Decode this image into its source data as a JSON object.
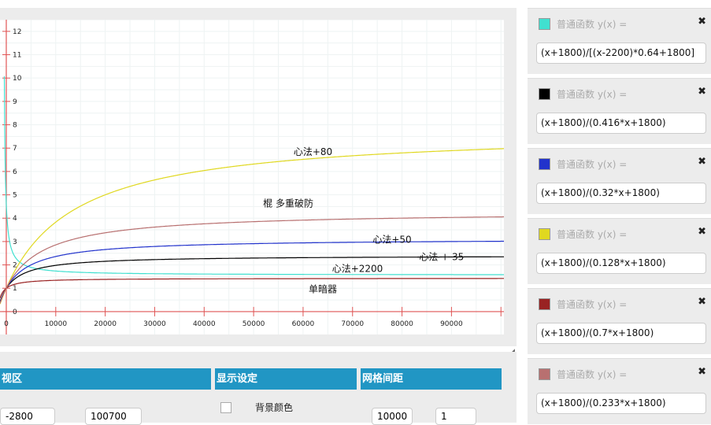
{
  "chart_data": {
    "type": "line",
    "xlim": [
      -1270,
      100600
    ],
    "ylim": [
      -0.98,
      12.5
    ],
    "x_ticks": [
      0,
      10000,
      20000,
      30000,
      40000,
      50000,
      60000,
      70000,
      80000,
      90000
    ],
    "y_ticks": [
      0,
      1,
      2,
      3,
      4,
      5,
      6,
      7,
      8,
      9,
      10,
      11,
      12
    ],
    "grid": true,
    "series": [
      {
        "name": "心法+2200",
        "expr": "(x+1800)/[(x-2200)*0.64+1800]",
        "color": "#40e0d0",
        "a": 0.64,
        "shift": 2200
      },
      {
        "name": "心法 + 35",
        "expr": "(x+1800)/(0.416*x+1800)",
        "color": "#000000",
        "a": 0.416,
        "shift": 0
      },
      {
        "name": "心法+50",
        "expr": "(x+1800)/(0.32*x+1800)",
        "color": "#2233cc",
        "a": 0.32,
        "shift": 0
      },
      {
        "name": "心法+80",
        "expr": "(x+1800)/(0.128*x+1800)",
        "color": "#e0d820",
        "a": 0.128,
        "shift": 0
      },
      {
        "name": "单暗器",
        "expr": "(x+1800)/(0.7*x+1800)",
        "color": "#992222",
        "a": 0.7,
        "shift": 0
      },
      {
        "name": "棍 多重破防",
        "expr": "(x+1800)/(0.233*x+1800)",
        "color": "#b87070",
        "a": 0.233,
        "shift": 0
      }
    ],
    "annotations": [
      {
        "text": "心法+80",
        "x": 62000,
        "y": 6.7
      },
      {
        "text": "棍 多重破防",
        "x": 57000,
        "y": 4.5
      },
      {
        "text": "心法+50",
        "x": 78000,
        "y": 2.95
      },
      {
        "text": "心法 + 35",
        "x": 88000,
        "y": 2.2
      },
      {
        "text": "心法+2200",
        "x": 71000,
        "y": 1.7
      },
      {
        "text": "单暗器",
        "x": 64000,
        "y": 0.82
      }
    ]
  },
  "bottom": {
    "viewport_label": "视区",
    "display_label": "显示设定",
    "grid_label": "网格间距",
    "x_min": "-2800",
    "x_max": "100700",
    "bg_color_label": "背景颜色",
    "grid_x": "10000",
    "grid_y": "1"
  },
  "functions": {
    "type_label": "普通函数 y(x) =",
    "close": "✖",
    "items": [
      {
        "expr": "(x+1800)/[(x-2200)*0.64+1800]",
        "color": "#40e0d0"
      },
      {
        "expr": "(x+1800)/(0.416*x+1800)",
        "color": "#000000"
      },
      {
        "expr": "(x+1800)/(0.32*x+1800)",
        "color": "#2233cc"
      },
      {
        "expr": "(x+1800)/(0.128*x+1800)",
        "color": "#e0d820"
      },
      {
        "expr": "(x+1800)/(0.7*x+1800)",
        "color": "#992222"
      },
      {
        "expr": "(x+1800)/(0.233*x+1800)",
        "color": "#b87070"
      }
    ]
  }
}
